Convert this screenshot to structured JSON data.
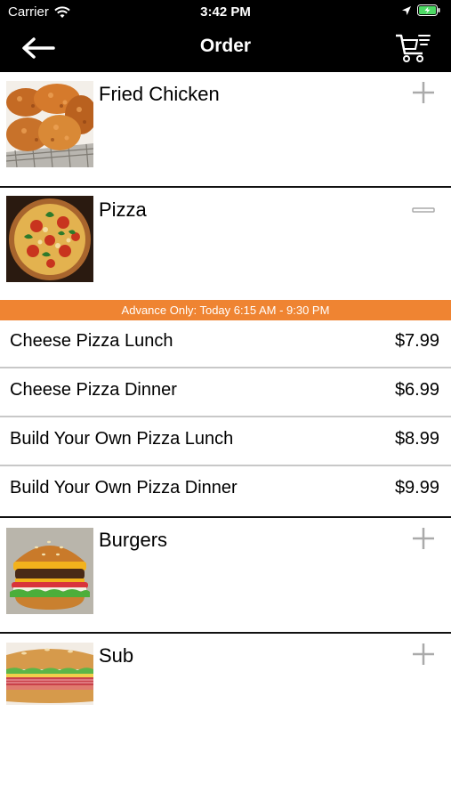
{
  "status": {
    "carrier": "Carrier",
    "time": "3:42 PM"
  },
  "nav": {
    "title": "Order",
    "back_icon": "back-arrow-icon",
    "cart_icon": "cart-icon"
  },
  "categories": [
    {
      "name": "Fried Chicken",
      "expanded": false
    },
    {
      "name": "Pizza",
      "expanded": true
    },
    {
      "name": "Burgers",
      "expanded": false
    },
    {
      "name": "Sub",
      "expanded": false
    }
  ],
  "pizza_section": {
    "availability": "Advance Only: Today 6:15 AM - 9:30 PM",
    "items": [
      {
        "label": "Cheese Pizza Lunch",
        "price": "$7.99"
      },
      {
        "label": "Cheese Pizza Dinner",
        "price": "$6.99"
      },
      {
        "label": "Build Your Own Pizza Lunch",
        "price": "$8.99"
      },
      {
        "label": "Build Your Own Pizza Dinner",
        "price": "$9.99"
      }
    ]
  },
  "colors": {
    "header_bg": "#000000",
    "banner_bg": "#ef8432",
    "battery": "#4cd964"
  }
}
